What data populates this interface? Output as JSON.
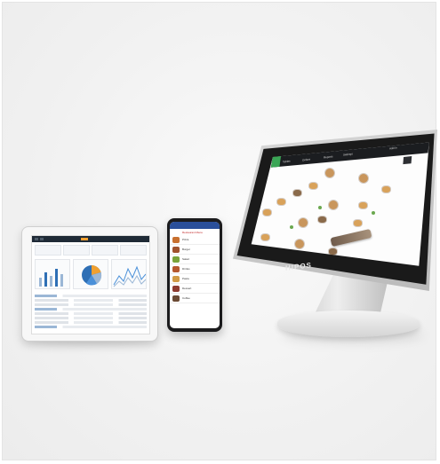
{
  "brand": {
    "logo_text": "HIPOS"
  },
  "pos_screen": {
    "top_bar_items": [
      "Tables",
      "Orders",
      "Reports",
      "Settings"
    ],
    "user_label": "Admin"
  },
  "phone_app": {
    "title": "Restaurant Menu",
    "categories": [
      {
        "label": "Pizza",
        "color": "#c8702f"
      },
      {
        "label": "Burger",
        "color": "#a0522d"
      },
      {
        "label": "Salad",
        "color": "#7aa33a"
      },
      {
        "label": "Drinks",
        "color": "#b5582e"
      },
      {
        "label": "Pasta",
        "color": "#d19a45"
      },
      {
        "label": "Dessert",
        "color": "#8e3b2f"
      },
      {
        "label": "Coffee",
        "color": "#6b4a34"
      }
    ]
  },
  "tablet_dashboard": {
    "accent_color": "#f0a030",
    "pie_colors": [
      "#2e6fb5",
      "#f0a030",
      "#9bb7d6",
      "#4a90d9"
    ]
  },
  "colors": {
    "pos_accent": "#3aa655",
    "phone_header": "#2a4f9a"
  }
}
